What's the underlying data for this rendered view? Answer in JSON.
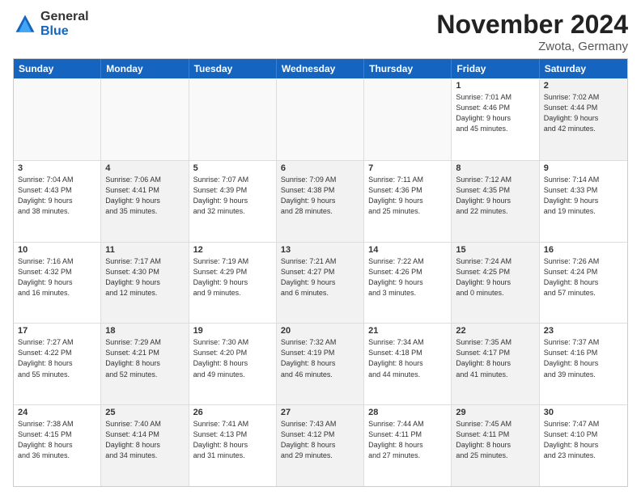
{
  "header": {
    "logo_general": "General",
    "logo_blue": "Blue",
    "month_year": "November 2024",
    "location": "Zwota, Germany"
  },
  "weekdays": [
    "Sunday",
    "Monday",
    "Tuesday",
    "Wednesday",
    "Thursday",
    "Friday",
    "Saturday"
  ],
  "rows": [
    [
      {
        "day": "",
        "info": "",
        "empty": true
      },
      {
        "day": "",
        "info": "",
        "empty": true
      },
      {
        "day": "",
        "info": "",
        "empty": true
      },
      {
        "day": "",
        "info": "",
        "empty": true
      },
      {
        "day": "",
        "info": "",
        "empty": true
      },
      {
        "day": "1",
        "info": "Sunrise: 7:01 AM\nSunset: 4:46 PM\nDaylight: 9 hours\nand 45 minutes.",
        "empty": false,
        "gray": false
      },
      {
        "day": "2",
        "info": "Sunrise: 7:02 AM\nSunset: 4:44 PM\nDaylight: 9 hours\nand 42 minutes.",
        "empty": false,
        "gray": true
      }
    ],
    [
      {
        "day": "3",
        "info": "Sunrise: 7:04 AM\nSunset: 4:43 PM\nDaylight: 9 hours\nand 38 minutes.",
        "empty": false,
        "gray": false
      },
      {
        "day": "4",
        "info": "Sunrise: 7:06 AM\nSunset: 4:41 PM\nDaylight: 9 hours\nand 35 minutes.",
        "empty": false,
        "gray": true
      },
      {
        "day": "5",
        "info": "Sunrise: 7:07 AM\nSunset: 4:39 PM\nDaylight: 9 hours\nand 32 minutes.",
        "empty": false,
        "gray": false
      },
      {
        "day": "6",
        "info": "Sunrise: 7:09 AM\nSunset: 4:38 PM\nDaylight: 9 hours\nand 28 minutes.",
        "empty": false,
        "gray": true
      },
      {
        "day": "7",
        "info": "Sunrise: 7:11 AM\nSunset: 4:36 PM\nDaylight: 9 hours\nand 25 minutes.",
        "empty": false,
        "gray": false
      },
      {
        "day": "8",
        "info": "Sunrise: 7:12 AM\nSunset: 4:35 PM\nDaylight: 9 hours\nand 22 minutes.",
        "empty": false,
        "gray": true
      },
      {
        "day": "9",
        "info": "Sunrise: 7:14 AM\nSunset: 4:33 PM\nDaylight: 9 hours\nand 19 minutes.",
        "empty": false,
        "gray": false
      }
    ],
    [
      {
        "day": "10",
        "info": "Sunrise: 7:16 AM\nSunset: 4:32 PM\nDaylight: 9 hours\nand 16 minutes.",
        "empty": false,
        "gray": false
      },
      {
        "day": "11",
        "info": "Sunrise: 7:17 AM\nSunset: 4:30 PM\nDaylight: 9 hours\nand 12 minutes.",
        "empty": false,
        "gray": true
      },
      {
        "day": "12",
        "info": "Sunrise: 7:19 AM\nSunset: 4:29 PM\nDaylight: 9 hours\nand 9 minutes.",
        "empty": false,
        "gray": false
      },
      {
        "day": "13",
        "info": "Sunrise: 7:21 AM\nSunset: 4:27 PM\nDaylight: 9 hours\nand 6 minutes.",
        "empty": false,
        "gray": true
      },
      {
        "day": "14",
        "info": "Sunrise: 7:22 AM\nSunset: 4:26 PM\nDaylight: 9 hours\nand 3 minutes.",
        "empty": false,
        "gray": false
      },
      {
        "day": "15",
        "info": "Sunrise: 7:24 AM\nSunset: 4:25 PM\nDaylight: 9 hours\nand 0 minutes.",
        "empty": false,
        "gray": true
      },
      {
        "day": "16",
        "info": "Sunrise: 7:26 AM\nSunset: 4:24 PM\nDaylight: 8 hours\nand 57 minutes.",
        "empty": false,
        "gray": false
      }
    ],
    [
      {
        "day": "17",
        "info": "Sunrise: 7:27 AM\nSunset: 4:22 PM\nDaylight: 8 hours\nand 55 minutes.",
        "empty": false,
        "gray": false
      },
      {
        "day": "18",
        "info": "Sunrise: 7:29 AM\nSunset: 4:21 PM\nDaylight: 8 hours\nand 52 minutes.",
        "empty": false,
        "gray": true
      },
      {
        "day": "19",
        "info": "Sunrise: 7:30 AM\nSunset: 4:20 PM\nDaylight: 8 hours\nand 49 minutes.",
        "empty": false,
        "gray": false
      },
      {
        "day": "20",
        "info": "Sunrise: 7:32 AM\nSunset: 4:19 PM\nDaylight: 8 hours\nand 46 minutes.",
        "empty": false,
        "gray": true
      },
      {
        "day": "21",
        "info": "Sunrise: 7:34 AM\nSunset: 4:18 PM\nDaylight: 8 hours\nand 44 minutes.",
        "empty": false,
        "gray": false
      },
      {
        "day": "22",
        "info": "Sunrise: 7:35 AM\nSunset: 4:17 PM\nDaylight: 8 hours\nand 41 minutes.",
        "empty": false,
        "gray": true
      },
      {
        "day": "23",
        "info": "Sunrise: 7:37 AM\nSunset: 4:16 PM\nDaylight: 8 hours\nand 39 minutes.",
        "empty": false,
        "gray": false
      }
    ],
    [
      {
        "day": "24",
        "info": "Sunrise: 7:38 AM\nSunset: 4:15 PM\nDaylight: 8 hours\nand 36 minutes.",
        "empty": false,
        "gray": false
      },
      {
        "day": "25",
        "info": "Sunrise: 7:40 AM\nSunset: 4:14 PM\nDaylight: 8 hours\nand 34 minutes.",
        "empty": false,
        "gray": true
      },
      {
        "day": "26",
        "info": "Sunrise: 7:41 AM\nSunset: 4:13 PM\nDaylight: 8 hours\nand 31 minutes.",
        "empty": false,
        "gray": false
      },
      {
        "day": "27",
        "info": "Sunrise: 7:43 AM\nSunset: 4:12 PM\nDaylight: 8 hours\nand 29 minutes.",
        "empty": false,
        "gray": true
      },
      {
        "day": "28",
        "info": "Sunrise: 7:44 AM\nSunset: 4:11 PM\nDaylight: 8 hours\nand 27 minutes.",
        "empty": false,
        "gray": false
      },
      {
        "day": "29",
        "info": "Sunrise: 7:45 AM\nSunset: 4:11 PM\nDaylight: 8 hours\nand 25 minutes.",
        "empty": false,
        "gray": true
      },
      {
        "day": "30",
        "info": "Sunrise: 7:47 AM\nSunset: 4:10 PM\nDaylight: 8 hours\nand 23 minutes.",
        "empty": false,
        "gray": false
      }
    ]
  ]
}
